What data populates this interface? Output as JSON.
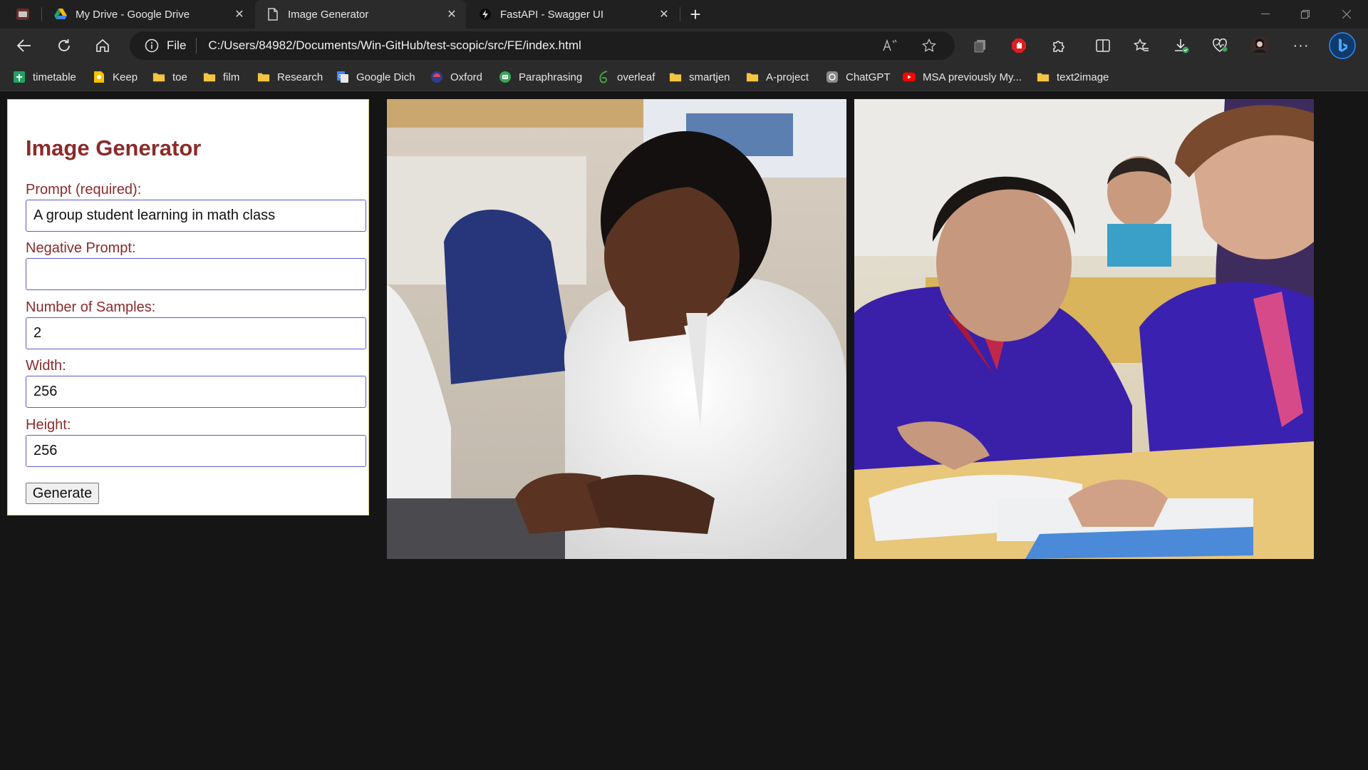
{
  "browser": {
    "tabs": [
      {
        "title": "My Drive - Google Drive",
        "icon": "google-drive-icon"
      },
      {
        "title": "Image Generator",
        "icon": "document-icon"
      },
      {
        "title": "FastAPI - Swagger UI",
        "icon": "fastapi-icon"
      }
    ],
    "address": {
      "scheme": "File",
      "url": "C:/Users/84982/Documents/Win-GitHub/test-scopic/src/FE/index.html"
    },
    "bookmarks": [
      {
        "label": "timetable",
        "icon": "sheets-icon"
      },
      {
        "label": "Keep",
        "icon": "keep-icon"
      },
      {
        "label": "toe",
        "icon": "folder-icon"
      },
      {
        "label": "film",
        "icon": "folder-icon"
      },
      {
        "label": "Research",
        "icon": "folder-icon"
      },
      {
        "label": "Google Dich",
        "icon": "google-translate-icon"
      },
      {
        "label": "Oxford",
        "icon": "oxford-icon"
      },
      {
        "label": "Paraphrasing",
        "icon": "robot-icon"
      },
      {
        "label": "overleaf",
        "icon": "overleaf-icon"
      },
      {
        "label": "smartjen",
        "icon": "folder-icon"
      },
      {
        "label": "A-project",
        "icon": "folder-icon"
      },
      {
        "label": "ChatGPT",
        "icon": "chatgpt-icon"
      },
      {
        "label": "MSA previously My...",
        "icon": "youtube-icon"
      },
      {
        "label": "text2image",
        "icon": "folder-icon"
      }
    ]
  },
  "form": {
    "title": "Image Generator",
    "prompt_label": "Prompt (required):",
    "prompt_value": "A group student learning in math class",
    "negative_label": "Negative Prompt:",
    "negative_value": "",
    "samples_label": "Number of Samples:",
    "samples_value": "2",
    "width_label": "Width:",
    "width_value": "256",
    "height_label": "Height:",
    "height_value": "256",
    "generate_label": "Generate"
  },
  "images": [
    {
      "subject": "boy-in-white-shirt-writing"
    },
    {
      "subject": "students-in-purple-uniform-writing"
    }
  ]
}
